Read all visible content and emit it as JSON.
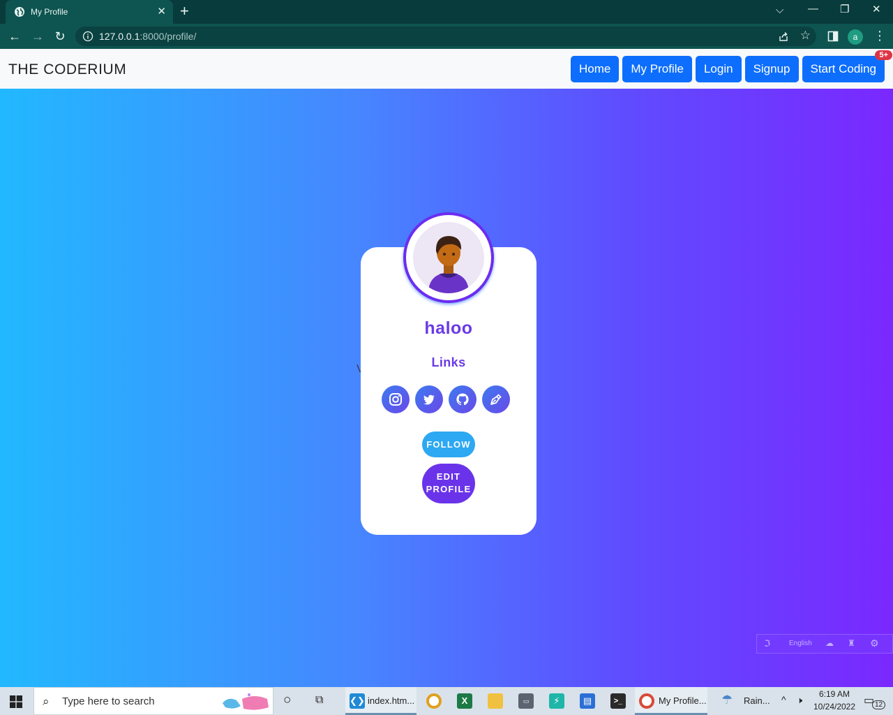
{
  "browser": {
    "tab_title": "My Profile",
    "tab_close": "✕",
    "new_tab": "+",
    "url_host": "127.0.0.1",
    "url_rest": ":8000/profile/",
    "profile_letter": "a",
    "window_controls": {
      "dropdown": "⌵",
      "minimize": "—",
      "restore": "❐",
      "close": "✕"
    }
  },
  "site": {
    "brand": "THE CODERIUM",
    "nav": [
      {
        "label": "Home"
      },
      {
        "label": "My Profile"
      },
      {
        "label": "Login"
      },
      {
        "label": "Signup"
      },
      {
        "label": "Start Coding"
      }
    ],
    "notification_badge": "5+"
  },
  "profile": {
    "name": "haloo",
    "links_title": "Links",
    "socials": [
      "instagram-icon",
      "twitter-icon",
      "github-icon",
      "pen-tool-icon"
    ],
    "follow_label": "FOLLOW",
    "edit_label_line1": "EDIT",
    "edit_label_line2": "PROFILE",
    "stray_text": "V"
  },
  "language_widget": {
    "label": "English"
  },
  "taskbar": {
    "search_placeholder": "Type here to search",
    "apps": [
      {
        "label": "index.htm..."
      },
      {
        "label": "My Profile..."
      }
    ],
    "weather": "Rain...",
    "time": "6:19 AM",
    "date": "10/24/2022",
    "notifications": "12"
  },
  "colors": {
    "accent_purple": "#6b3ae6",
    "nav_blue": "#0d6efd",
    "follow_blue": "#2da8f2",
    "edit_purple": "#6a33ea",
    "badge_red": "#dc3545"
  }
}
